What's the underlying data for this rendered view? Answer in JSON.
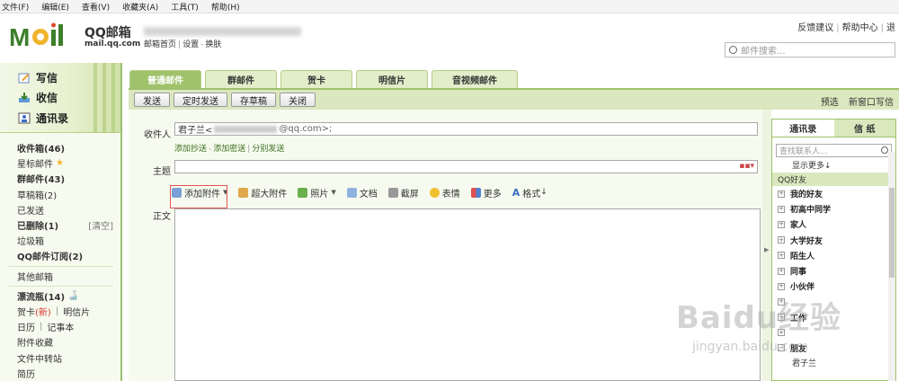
{
  "menubar": [
    "文件(F)",
    "编辑(E)",
    "查看(V)",
    "收藏夹(A)",
    "工具(T)",
    "帮助(H)"
  ],
  "header": {
    "brand": "QQ邮箱",
    "domain": "mail.qq.com",
    "links": [
      "邮箱首页",
      "设置",
      "换肤"
    ],
    "top_links": [
      "反馈建议",
      "帮助中心",
      "退"
    ],
    "search_placeholder": "邮件搜索..."
  },
  "sidebar": {
    "quick_actions": [
      "写信",
      "收信",
      "通讯录"
    ],
    "folders": [
      {
        "label": "收件箱(46)",
        "bold": true
      },
      {
        "label": "星标邮件",
        "star": true
      },
      {
        "label": "群邮件(43)",
        "bold": true
      },
      {
        "label": "草稿箱(2)"
      },
      {
        "label": "已发送"
      },
      {
        "label": "已删除(1)",
        "bold": true,
        "action": "[清空]"
      },
      {
        "label": "垃圾箱"
      },
      {
        "label": "QQ邮件订阅(2)",
        "bold": true
      }
    ],
    "other": "其他邮箱",
    "drift": "漂流瓶(14)",
    "card_new": "新",
    "cards": [
      "贺卡",
      "明信片"
    ],
    "calendar": [
      "日历",
      "记事本"
    ],
    "extras": [
      "附件收藏",
      "文件中转站",
      "简历"
    ]
  },
  "tabs": [
    "普通邮件",
    "群邮件",
    "贺卡",
    "明信片",
    "音视频邮件"
  ],
  "toolbar": {
    "buttons": [
      "发送",
      "定时发送",
      "存草稿",
      "关闭"
    ],
    "right": [
      "预选",
      "新窗口写信"
    ]
  },
  "compose": {
    "to_label": "收件人",
    "to_name": "君子兰<",
    "to_suffix": "@qq.com>;",
    "cc_links": [
      "添加抄送",
      "添加密送",
      "分别发送"
    ],
    "subject_label": "主题",
    "body_label": "正文",
    "format_tools": [
      "添加附件",
      "超大附件",
      "照片",
      "文档",
      "截屏",
      "表情",
      "更多",
      "格式"
    ]
  },
  "contacts": {
    "tabs": [
      "通讯录",
      "信 纸"
    ],
    "search_placeholder": "查找联系人...",
    "show_more": "显示更多↓",
    "group_head": "QQ好友",
    "groups": [
      {
        "label": "我的好友",
        "state": "+"
      },
      {
        "label": "初高中同学",
        "state": "+"
      },
      {
        "label": "家人",
        "state": "+"
      },
      {
        "label": "大学好友",
        "state": "+"
      },
      {
        "label": "陌生人",
        "state": "+"
      },
      {
        "label": "同事",
        "state": "+"
      },
      {
        "label": "小伙伴",
        "state": "+"
      },
      {
        "label": "",
        "state": "+"
      },
      {
        "label": "工作",
        "state": "+"
      },
      {
        "label": "",
        "state": "+"
      },
      {
        "label": "朋友",
        "state": "−"
      }
    ],
    "expanded_contact": "君子兰"
  },
  "watermark": {
    "main": "Baidu经验",
    "sub": "jingyan.baidu.com"
  },
  "colors": {
    "accent": "#9fc26b",
    "panel": "#dbe8bf",
    "link": "#3b6e1e"
  }
}
